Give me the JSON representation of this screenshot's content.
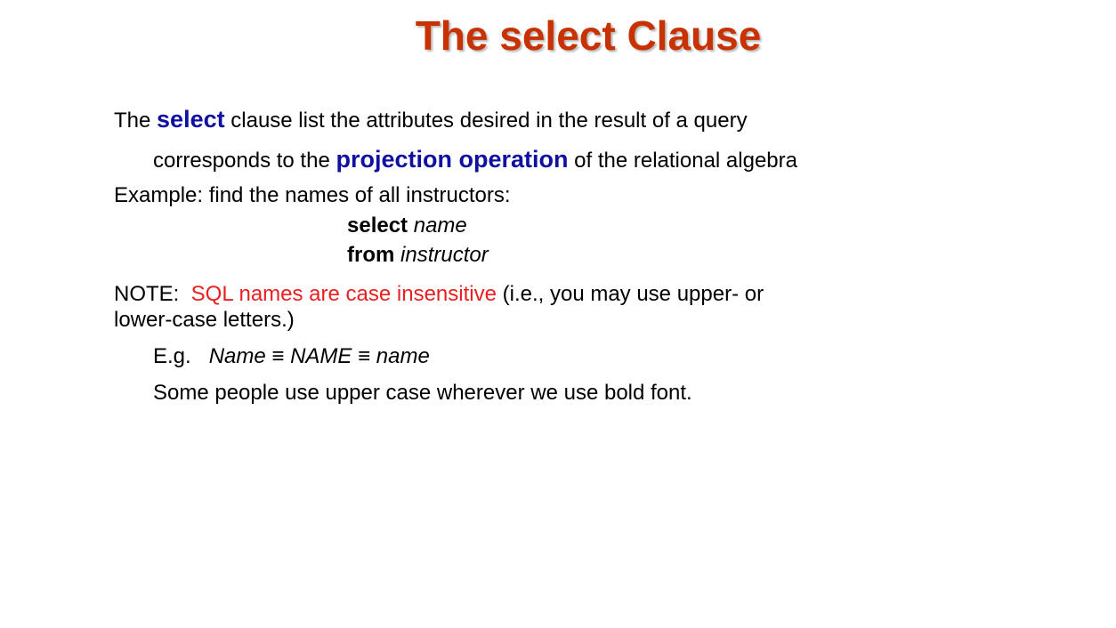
{
  "slide": {
    "title": "The select Clause",
    "line1": {
      "pre": "The ",
      "keyword": "select",
      "post": " clause list the attributes desired in the result of a query"
    },
    "line2": {
      "pre": "corresponds to the ",
      "keyword": "projection operation",
      "post": " of the relational algebra"
    },
    "example_intro": "Example: find the names of all instructors:",
    "query": {
      "select_kw": "select",
      "select_arg": "name",
      "from_kw": "from",
      "from_arg": "instructor"
    },
    "note": {
      "prefix": "NOTE:  ",
      "highlight": "SQL names are case insensitive",
      "suffix": " (i.e., you may use upper- or",
      "continuation": "lower-case letters.)"
    },
    "eg": {
      "label": "E.g.   ",
      "variant1": "Name",
      "equiv1": " ≡ ",
      "variant2": "NAME",
      "equiv2": " ≡ ",
      "variant3": "name"
    },
    "bold_note": "Some people use upper case wherever we use bold font."
  },
  "colors": {
    "title": "#c83200",
    "keyword_blue": "#1010a0",
    "highlight_red": "#e82020"
  }
}
